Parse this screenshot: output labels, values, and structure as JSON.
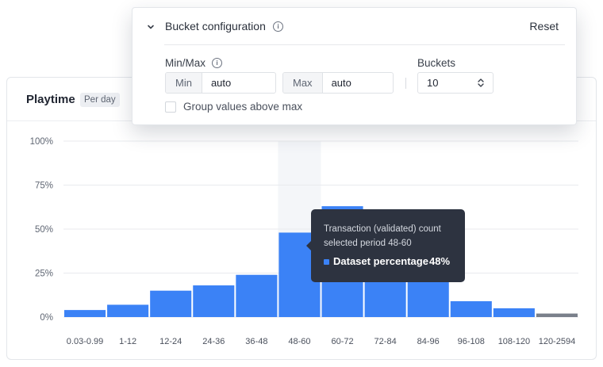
{
  "card": {
    "title": "Playtime",
    "badge": "Per day"
  },
  "popover": {
    "title": "Bucket configuration",
    "reset_label": "Reset",
    "minmax_label": "Min/Max",
    "min_addon": "Min",
    "min_value": "auto",
    "max_addon": "Max",
    "max_value": "auto",
    "buckets_label": "Buckets",
    "buckets_value": "10",
    "group_label": "Group values above max",
    "group_checked": false
  },
  "tooltip": {
    "line1": "Transaction (validated) count",
    "line2": "selected period 48-60",
    "series_label": "Dataset percentage",
    "value": "48%"
  },
  "colors": {
    "bar": "#3b82f6",
    "bar_overflow": "#7a808b",
    "hover_band": "#f4f6f9",
    "tooltip_bg": "#2d3340"
  },
  "chart_data": {
    "type": "bar",
    "categories": [
      "0.03-0.99",
      "1-12",
      "12-24",
      "24-36",
      "36-48",
      "48-60",
      "60-72",
      "72-84",
      "84-96",
      "96-108",
      "108-120",
      "120-2594"
    ],
    "values": [
      4,
      7,
      15,
      18,
      24,
      48,
      63,
      40,
      32,
      9,
      5,
      2
    ],
    "ytick_labels": [
      "100%",
      "75%",
      "50%",
      "25%",
      "0%"
    ],
    "ytick_values": [
      100,
      75,
      50,
      25,
      0
    ],
    "ylim": [
      0,
      100
    ],
    "highlighted_index": 5,
    "overflow_index": 11,
    "grid": true
  }
}
